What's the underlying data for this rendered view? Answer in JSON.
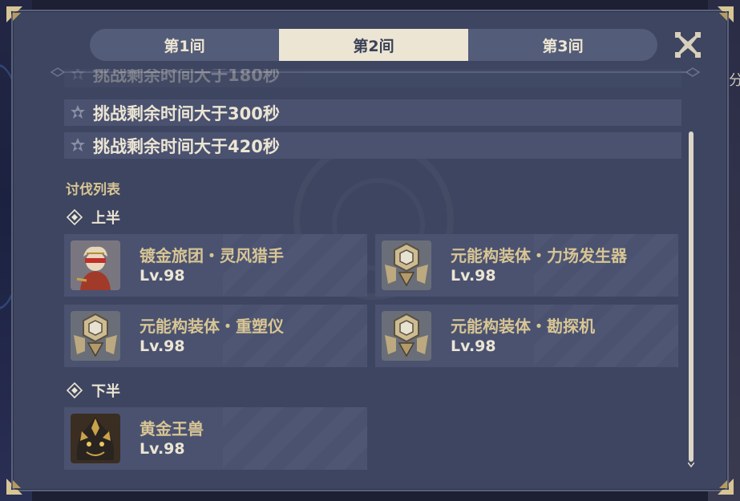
{
  "tabs": [
    {
      "label": "第1间",
      "active": false
    },
    {
      "label": "第2间",
      "active": true
    },
    {
      "label": "第3间",
      "active": false
    }
  ],
  "close_icon": "close-x-icon",
  "conditions": [
    {
      "text": "挑战剩余时间大于180秒",
      "icon": "star-icon"
    },
    {
      "text": "挑战剩余时间大于300秒",
      "icon": "star-icon"
    },
    {
      "text": "挑战剩余时间大于420秒",
      "icon": "star-icon"
    }
  ],
  "enemy_list": {
    "title": "讨伐列表",
    "first_half": {
      "label": "上半",
      "enemies": [
        {
          "name": "镀金旅团・灵风猎手",
          "level": "Lv.98",
          "icon": "gilded-brigade-avatar"
        },
        {
          "name": "元能构装体・力场发生器",
          "level": "Lv.98",
          "icon": "construct-avatar"
        },
        {
          "name": "元能构装体・重塑仪",
          "level": "Lv.98",
          "icon": "construct-avatar"
        },
        {
          "name": "元能构装体・勘探机",
          "level": "Lv.98",
          "icon": "construct-avatar"
        }
      ]
    },
    "second_half": {
      "label": "下半",
      "enemies": [
        {
          "name": "黄金王兽",
          "level": "Lv.98",
          "icon": "golden-wolflord-avatar"
        }
      ]
    }
  },
  "background_text": "分",
  "colors": {
    "panel": "#3d4560",
    "card": "#4a5270",
    "accent_gold": "#d8c594",
    "text_light": "#ece5d3",
    "tab_active": "#ece5d3"
  }
}
